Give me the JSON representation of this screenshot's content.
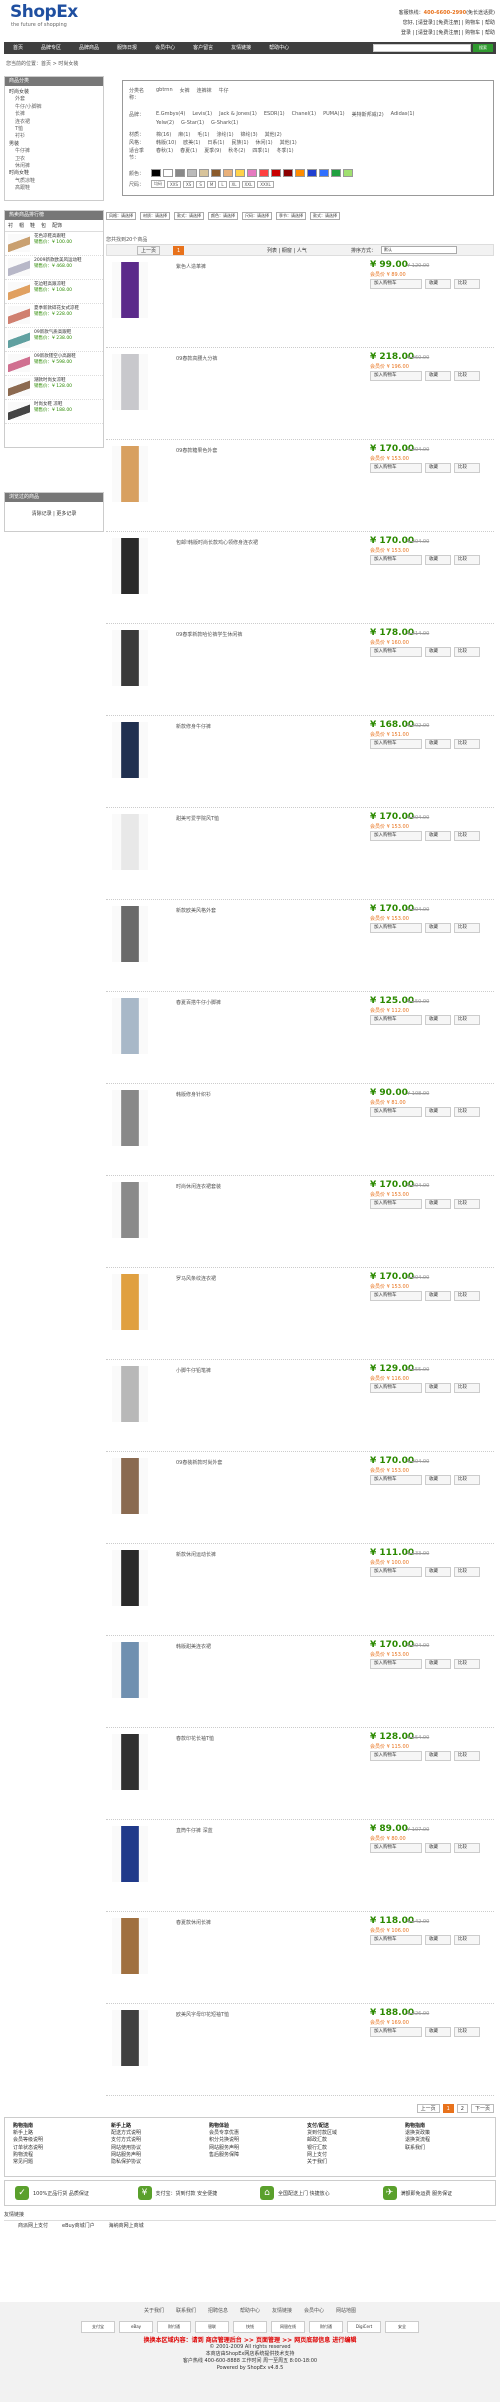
{
  "header": {
    "logo_main": "ShopEx",
    "logo_slogan": "the future of shopping",
    "phone_label": "客服热线：",
    "phone": "400-6600-2990",
    "phone_note": "(免长途话费)",
    "user_links": "您好, [请登录] [免费注册] | 购物车 | 帮助",
    "login_links": "登录 | [请登录] [免费注册] | 购物车 | 帮助"
  },
  "nav": {
    "items": [
      "首页",
      "品牌专区",
      "品牌商品",
      "服饰日报",
      "会员中心",
      "客户留言",
      "友情链接",
      "帮助中心"
    ],
    "search_button": "搜索"
  },
  "breadcrumb": "您当前的位置：首页 > 时尚女装",
  "sidebar": {
    "cat_title": "商品分类",
    "categories": [
      {
        "label": "时尚女装",
        "sub": [
          "外套",
          "牛仔/小脚裤",
          "长裤",
          "连衣裙",
          "T恤",
          "衬衫"
        ]
      },
      {
        "label": "男装",
        "sub": [
          "牛仔裤",
          "卫衣",
          "休闲裤"
        ]
      },
      {
        "label": "时尚女鞋",
        "sub": [
          "气质凉鞋",
          "高跟鞋"
        ]
      }
    ],
    "hot_title": "热卖商品排行榜",
    "hot_tabs": [
      "衬",
      "帽",
      "鞋",
      "包",
      "配饰"
    ],
    "hot_price_label": "销售价：",
    "hot_items": [
      {
        "name": "花色凉鞋高跟鞋",
        "price": "¥ 100.00"
      },
      {
        "name": "2009新款欧美风运动鞋",
        "price": "¥ 468.00"
      },
      {
        "name": "花边鞋高跟凉鞋",
        "price": "¥ 108.00"
      },
      {
        "name": "夏季新款碎花女式凉鞋",
        "price": "¥ 228.00"
      },
      {
        "name": "09新款气质高跟鞋",
        "price": "¥ 238.00"
      },
      {
        "name": "09新款镂空小高跟鞋",
        "price": "¥ 598.00"
      },
      {
        "name": "潮款时尚女凉鞋",
        "price": "¥ 128.00"
      },
      {
        "name": "时尚女鞋 凉鞋",
        "price": "¥ 188.00"
      }
    ],
    "browsed_title": "浏览过的商品",
    "browsed_links": "清除记录 | 更多记录"
  },
  "filter": {
    "brand_label": "分类名称：",
    "brand_top": [
      "gbtrnn",
      "女裤",
      "连裤袜",
      "牛仔"
    ],
    "brands_label": "品牌：",
    "brands_row1": [
      "E.Gmbys(4)",
      "Levis(1)",
      "Jack & Jones(1)",
      "ESDR(1)",
      "Chanel(1)",
      "PUMA(1)",
      "美特斯邦威(2)",
      "Adidas(1)"
    ],
    "brands_row2": [
      "Yelw(2)",
      "G-Star(1)",
      "G-Shark(1)"
    ],
    "material_label": "材质：",
    "materials": [
      "棉(16)",
      "麻(1)",
      "毛(1)",
      "涤纶(1)",
      "锦纶(3)",
      "其他(2)"
    ],
    "style_label": "风格：",
    "styles": [
      "韩版(10)",
      "欧美(1)",
      "日系(1)",
      "民族(1)",
      "休闲(1)",
      "其他(1)"
    ],
    "season_label": "适合季节：",
    "seasons": [
      "春秋(1)",
      "春夏(1)",
      "夏季(9)",
      "秋冬(2)",
      "四季(1)",
      "冬季(1)"
    ],
    "color_label": "颜色：",
    "colors": [
      "#000000",
      "#ffffff",
      "#888888",
      "#bbbbbb",
      "#d8c49b",
      "#8a5a2b",
      "#e8b07a",
      "#ffd24a",
      "#e57ac0",
      "#ff4040",
      "#c80000",
      "#8b0000",
      "#ff8c00",
      "#2040d0",
      "#3070ff",
      "#20a040",
      "#a0e070"
    ],
    "size_label": "尺码：",
    "sizes": [
      "均码",
      "XXS",
      "XS",
      "S",
      "M",
      "L",
      "XL",
      "XXL",
      "XXXL"
    ],
    "selects": [
      "风格：请选择",
      "材质：请选择",
      "款式：请选择",
      "颜色：请选择",
      "尺码：请选择",
      "季节：请选择",
      "款式：请选择"
    ]
  },
  "list": {
    "head": "您共找到20个商品",
    "sort_label": "排序方式：",
    "sort_value": "默认",
    "view_labels": "列表 | 橱窗 | 人气",
    "cart_btn": "加入购物车",
    "fav_btn": "收藏",
    "cmp_btn": "比较",
    "member_label": "会员价",
    "products": [
      {
        "name": "紫色人造革裤",
        "price": "¥ 99.00",
        "market": "¥ 120.00",
        "member": "¥ 89.00"
      },
      {
        "name": "09春款高腰九分裤",
        "price": "¥ 218.00",
        "market": "¥ 260.00",
        "member": "¥ 196.00"
      },
      {
        "name": "09春款糖果色外套",
        "price": "¥ 170.00",
        "market": "¥ 204.00",
        "member": "¥ 153.00"
      },
      {
        "name": "包邮!韩版时尚长款鸡心领修身连衣裙",
        "price": "¥ 170.00",
        "market": "¥ 204.00",
        "member": "¥ 153.00"
      },
      {
        "name": "09春季新款哈伦裤学生休闲裤",
        "price": "¥ 178.00",
        "market": "¥ 214.00",
        "member": "¥ 160.00"
      },
      {
        "name": "新款修身牛仔裤",
        "price": "¥ 168.00",
        "market": "¥ 202.00",
        "member": "¥ 151.00"
      },
      {
        "name": "甜美可爱学院风T恤",
        "price": "¥ 170.00",
        "market": "¥ 204.00",
        "member": "¥ 153.00"
      },
      {
        "name": "新款欧美风格外套",
        "price": "¥ 170.00",
        "market": "¥ 204.00",
        "member": "¥ 153.00"
      },
      {
        "name": "春夏百搭牛仔小脚裤",
        "price": "¥ 125.00",
        "market": "¥ 150.00",
        "member": "¥ 112.00"
      },
      {
        "name": "韩版修身针织衫",
        "price": "¥ 90.00",
        "market": "¥ 108.00",
        "member": "¥ 81.00"
      },
      {
        "name": "时尚休闲连衣裙套装",
        "price": "¥ 170.00",
        "market": "¥ 204.00",
        "member": "¥ 153.00"
      },
      {
        "name": "罗马风条纹连衣裙",
        "price": "¥ 170.00",
        "market": "¥ 204.00",
        "member": "¥ 153.00"
      },
      {
        "name": "小脚牛仔铅笔裤",
        "price": "¥ 129.00",
        "market": "¥ 155.00",
        "member": "¥ 116.00"
      },
      {
        "name": "09春装新款时尚外套",
        "price": "¥ 170.00",
        "market": "¥ 204.00",
        "member": "¥ 153.00"
      },
      {
        "name": "新款休闲运动长裤",
        "price": "¥ 111.00",
        "market": "¥ 133.00",
        "member": "¥ 100.00"
      },
      {
        "name": "韩版甜美连衣裙",
        "price": "¥ 170.00",
        "market": "¥ 204.00",
        "member": "¥ 153.00"
      },
      {
        "name": "春款印花长袖T恤",
        "price": "¥ 128.00",
        "market": "¥ 154.00",
        "member": "¥ 115.00"
      },
      {
        "name": "直筒牛仔裤 深蓝",
        "price": "¥ 89.00",
        "market": "¥ 107.00",
        "member": "¥ 80.00"
      },
      {
        "name": "春夏款休闲长裤",
        "price": "¥ 118.00",
        "market": "¥ 142.00",
        "member": "¥ 106.00"
      },
      {
        "name": "欧美风字母印花短袖T恤",
        "price": "¥ 188.00",
        "market": "¥ 226.00",
        "member": "¥ 169.00"
      }
    ],
    "pager_prev": "上一页",
    "pager_pages": [
      "1",
      "2"
    ],
    "pager_next": "下一页"
  },
  "help": [
    {
      "title": "购物指南",
      "items": [
        "新手上路",
        "会员等级说明",
        "订单状态说明",
        "购物流程",
        "常见问题"
      ]
    },
    {
      "title": "新手上路",
      "items": [
        "配送方式说明",
        "支付方式说明",
        "网站使用协议",
        "网站服务声明",
        "隐私保护协议"
      ]
    },
    {
      "title": "购物体验",
      "items": [
        "会员专享优惠",
        "积分兑换说明",
        "网站服务声明",
        "售后服务保障"
      ]
    },
    {
      "title": "支付/配送",
      "items": [
        "货到付款区域",
        "邮政汇款",
        "银行汇款",
        "网上支付",
        "关于我们"
      ]
    },
    {
      "title": "购物指南",
      "items": [
        "退换货政策",
        "退换货流程",
        "联系我们"
      ]
    }
  ],
  "service": [
    "100%正品行货 品质保证",
    "支付宝：货到付款 安全便捷",
    "全国配送上门 快捷放心",
    "满额即免运费 服务保证"
  ],
  "links": {
    "title": "友情链接",
    "items": [
      "商派网上支付",
      "eBuy商城门户",
      "海纳商网上商城"
    ]
  },
  "footer": {
    "links": [
      "关于我们",
      "联系我们",
      "招聘信息",
      "帮助中心",
      "友情链接",
      "会员中心",
      "网站地图"
    ],
    "badges": [
      "支付宝",
      "eBay",
      "财付通",
      "银联",
      "快钱",
      "网银在线",
      "财付通",
      "DigiCert",
      "安全"
    ],
    "redline": "换换本区域内容：请到 商店管理后台 >> 页面管理 >> 网页底部信息 进行编辑",
    "copyright": "© 2001-2009 All rights reserved",
    "line2": "本商店由ShopEx网店系统提供技术支持",
    "line3": "客户热线 400-600-8888 工作时间 周一至周五 8:00-18:00",
    "powered": "Powered by ShopEx v4.8.5"
  }
}
